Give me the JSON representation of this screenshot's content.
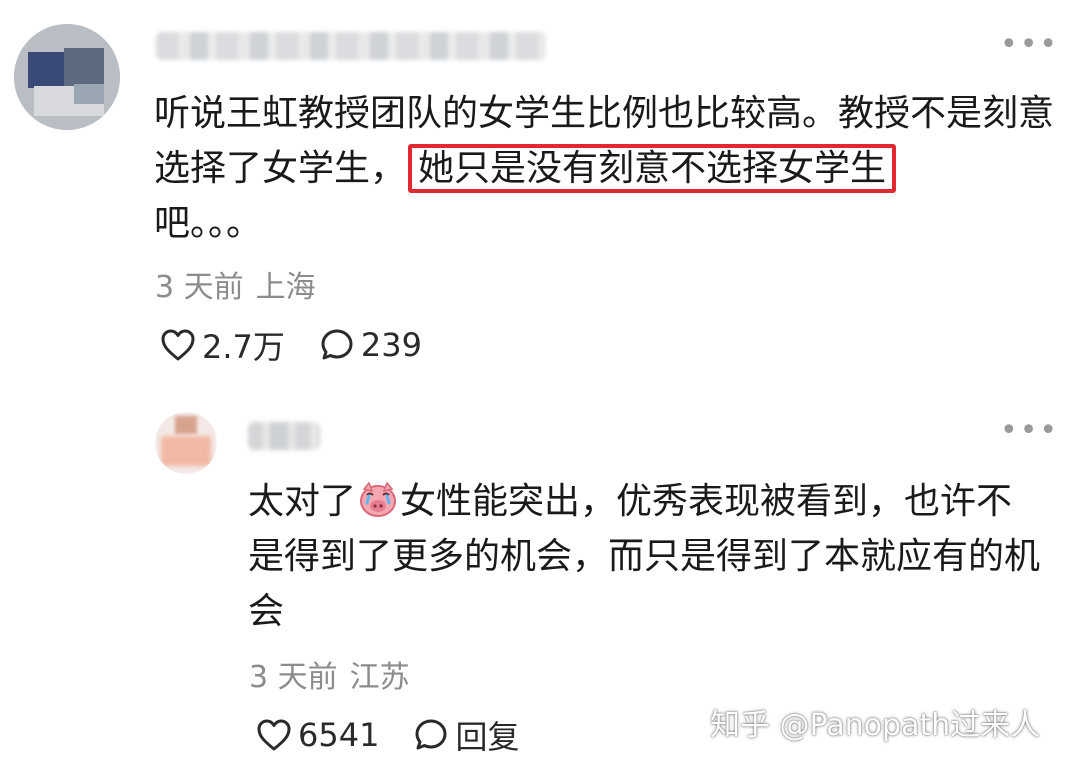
{
  "comment": {
    "text_before_highlight": "听说王虹教授团队的女学生比例也比较高。教授不是刻意选择了女学生，",
    "text_highlight": "她只是没有刻意不选择女学生",
    "text_after_highlight": "吧。。。",
    "time": "3 天前",
    "location": "上海",
    "likes": "2.7万",
    "replies": "239",
    "highlight_color": "#e0282e"
  },
  "reply": {
    "text_part1": "太对了",
    "emoji_icon": "crying-pig-emoji",
    "text_part2": "女性能突出，优秀表现被看到，也许不是得到了更多的机会，而只是得到了本就应有的机会",
    "time": "3 天前",
    "location": "江苏",
    "likes": "6541",
    "reply_label": "回复"
  },
  "watermark": "知乎 @Panopath过来人"
}
